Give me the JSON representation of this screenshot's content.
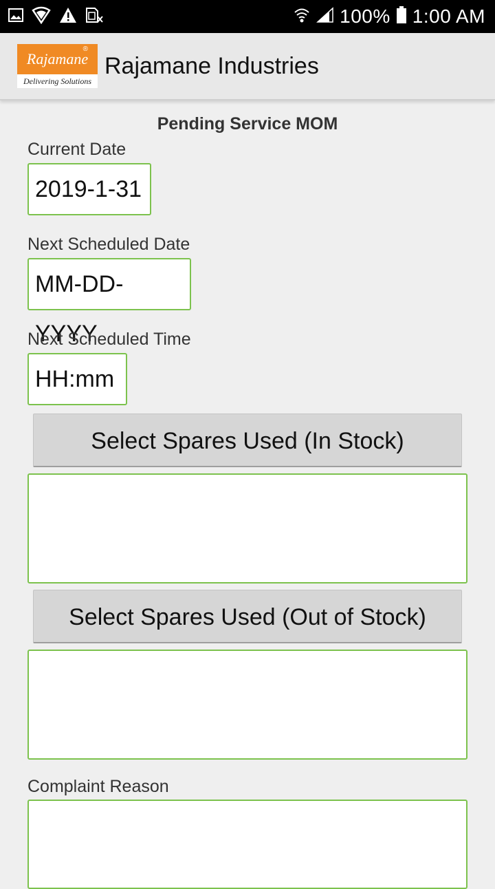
{
  "status_bar": {
    "battery_percent": "100%",
    "time": "1:00 AM",
    "icons": [
      "image-icon",
      "shield-icon",
      "warning-icon",
      "sim-icon",
      "wifi-icon",
      "signal-icon",
      "battery-icon"
    ]
  },
  "app_bar": {
    "logo_text": "Rajamane",
    "logo_tagline": "Delivering Solutions",
    "title": "Rajamane Industries",
    "brand_color": "#f08a24"
  },
  "form": {
    "title": "Pending Service MOM",
    "current_date_label": "Current Date",
    "current_date_value": "2019-1-31",
    "next_date_label": "Next Scheduled Date",
    "next_date_value": "MM-DD-YYYY",
    "next_time_label": "Next Scheduled Time",
    "next_time_value": "HH:mm",
    "in_stock_button": "Select Spares Used (In Stock)",
    "out_stock_button": "Select Spares Used (Out of Stock)",
    "complaint_label": "Complaint Reason",
    "accent_color": "#7cc24d"
  }
}
